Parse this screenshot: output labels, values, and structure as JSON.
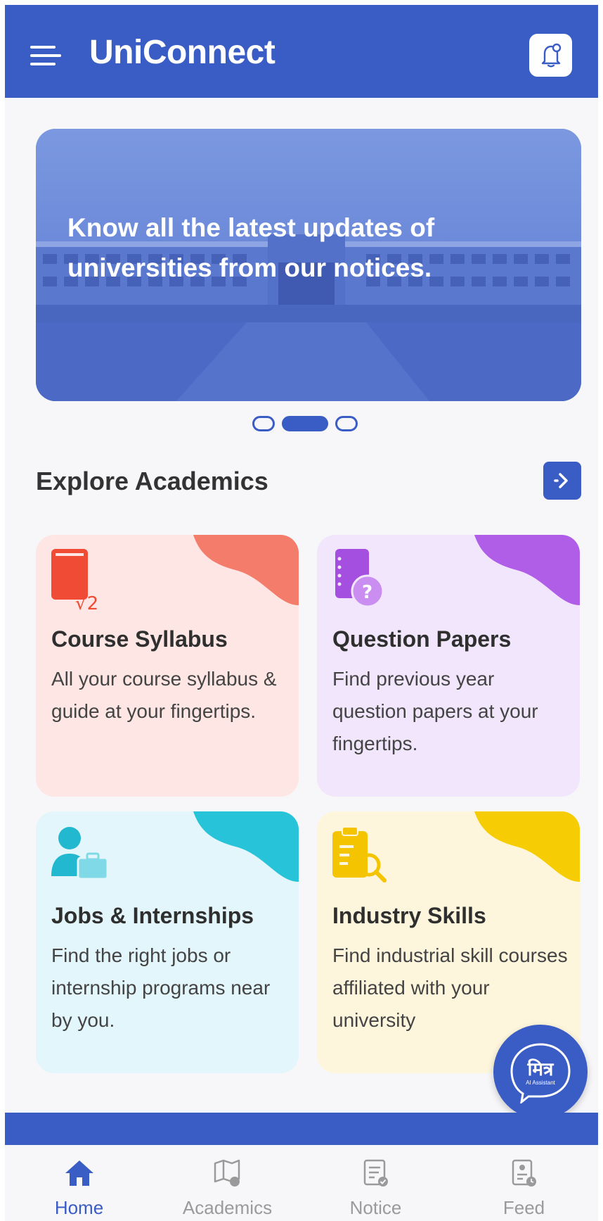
{
  "header": {
    "app_title": "UniConnect",
    "menu_icon": "menu-icon",
    "notification_icon": "bell-icon"
  },
  "banner": {
    "text": "Know all the latest updates of universities from our notices.",
    "carousel": {
      "total": 3,
      "active_index": 1
    }
  },
  "explore": {
    "title": "Explore Academics",
    "arrow_icon": "arrow-right-icon",
    "cards": [
      {
        "title": "Course Syllabus",
        "description": "All your course syllabus & guide at your fingertips.",
        "icon": "book-sqrt-icon",
        "accent": "#f47c6b",
        "background": "#fde6e3"
      },
      {
        "title": "Question Papers",
        "description": "Find previous year question papers at your fingertips.",
        "icon": "notebook-question-icon",
        "accent": "#b05de8",
        "background": "#f1e6fb"
      },
      {
        "title": "Jobs & Internships",
        "description": "Find the right jobs or internship programs near by you.",
        "icon": "person-briefcase-icon",
        "accent": "#27c3d8",
        "background": "#e3f6fb"
      },
      {
        "title": "Industry Skills",
        "description": "Find industrial skill courses affiliated with your university",
        "icon": "clipboard-search-icon",
        "accent": "#f6cd05",
        "background": "#fdf6dd"
      }
    ]
  },
  "assistant": {
    "label": "मित्र",
    "sublabel": "AI Assistant"
  },
  "bottom_nav": [
    {
      "label": "Home",
      "icon": "home-icon",
      "active": true
    },
    {
      "label": "Academics",
      "icon": "academics-icon",
      "active": false
    },
    {
      "label": "Notice",
      "icon": "notice-icon",
      "active": false
    },
    {
      "label": "Feed",
      "icon": "feed-icon",
      "active": false
    }
  ],
  "colors": {
    "primary": "#3a5cc5",
    "inactive_nav": "#9a9a9a"
  }
}
